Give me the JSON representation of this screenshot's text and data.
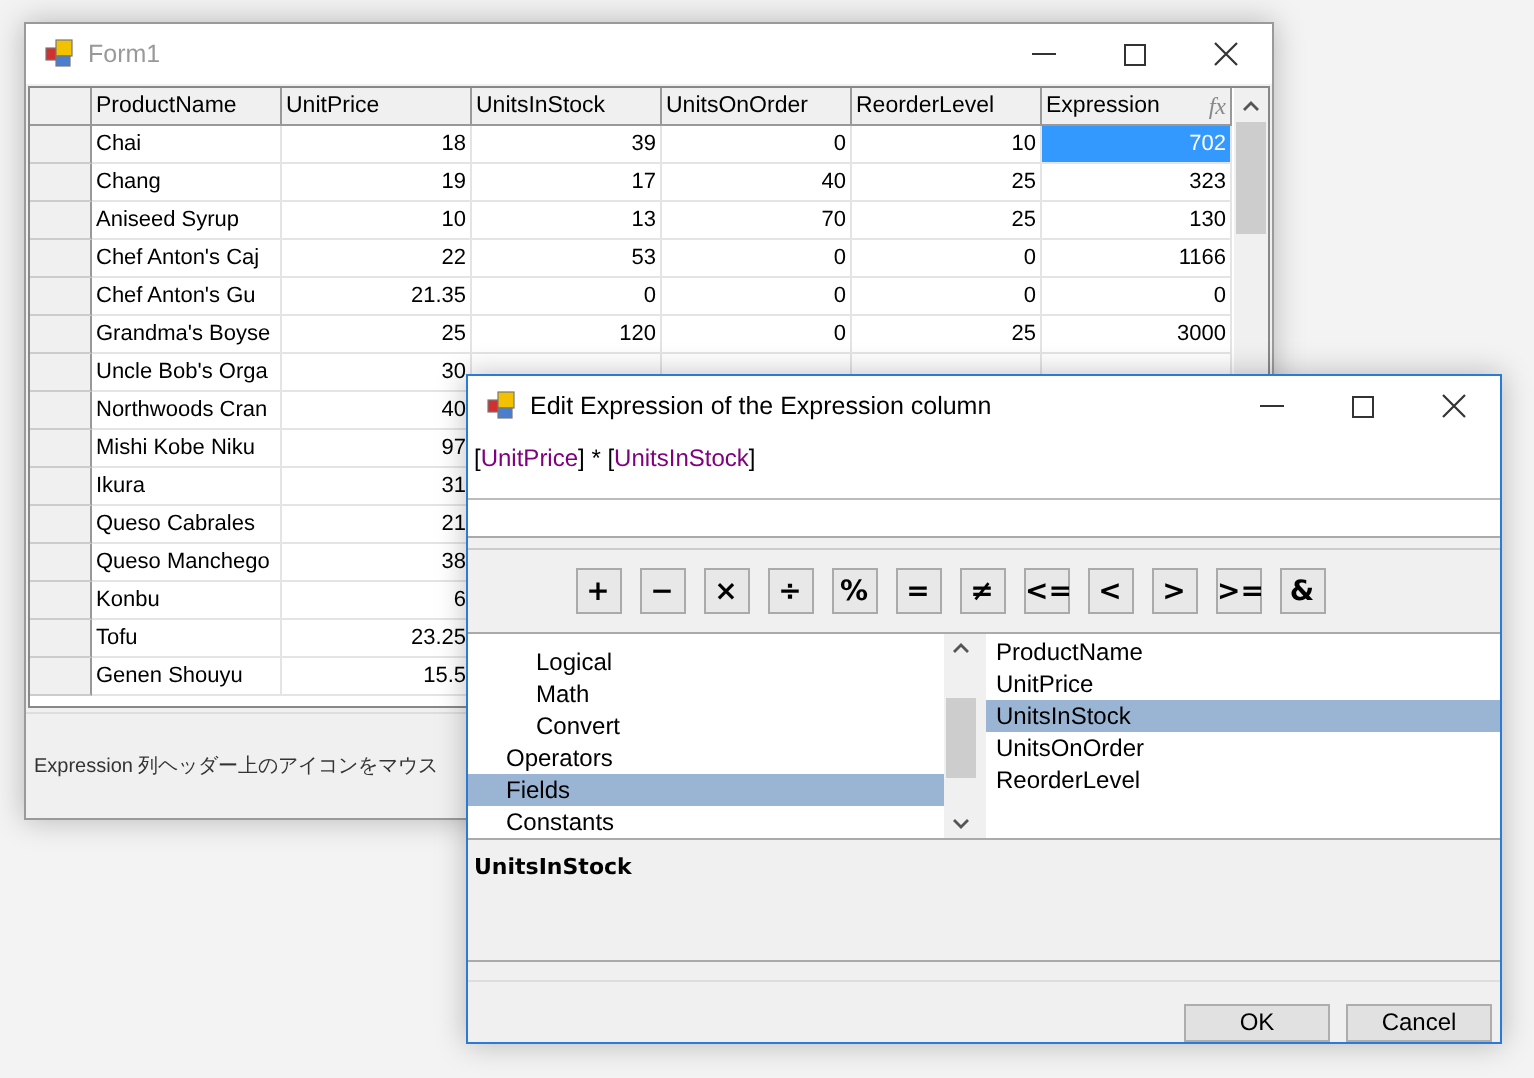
{
  "main_window": {
    "title": "Form1",
    "grid": {
      "columns": [
        "ProductName",
        "UnitPrice",
        "UnitsInStock",
        "UnitsOnOrder",
        "ReorderLevel",
        "Expression"
      ],
      "expression_header_icon": "fx",
      "rows": [
        {
          "cells": [
            "Chai",
            "18",
            "39",
            "0",
            "10"
          ],
          "expression": {
            "value": "702",
            "selected": true
          }
        },
        {
          "cells": [
            "Chang",
            "19",
            "17",
            "40",
            "25"
          ],
          "expression": {
            "value": "323",
            "selected": false
          }
        },
        {
          "cells": [
            "Aniseed Syrup",
            "10",
            "13",
            "70",
            "25"
          ],
          "expression": {
            "value": "130",
            "selected": false
          }
        },
        {
          "cells": [
            "Chef Anton's Caj",
            "22",
            "53",
            "0",
            "0"
          ],
          "expression": {
            "value": "1166",
            "selected": false
          }
        },
        {
          "cells": [
            "Chef Anton's Gu",
            "21.35",
            "0",
            "0",
            "0"
          ],
          "expression": {
            "value": "0",
            "selected": false
          }
        },
        {
          "cells": [
            "Grandma's Boyse",
            "25",
            "120",
            "0",
            "25"
          ],
          "expression": {
            "value": "3000",
            "selected": false
          }
        },
        {
          "cells": [
            "Uncle Bob's Orga",
            "30"
          ]
        },
        {
          "cells": [
            "Northwoods Cran",
            "40"
          ]
        },
        {
          "cells": [
            "Mishi Kobe Niku",
            "97"
          ]
        },
        {
          "cells": [
            "Ikura",
            "31"
          ]
        },
        {
          "cells": [
            "Queso Cabrales",
            "21"
          ]
        },
        {
          "cells": [
            "Queso Manchego",
            "38"
          ]
        },
        {
          "cells": [
            "Konbu",
            "6"
          ]
        },
        {
          "cells": [
            "Tofu",
            "23.25"
          ]
        },
        {
          "cells": [
            "Genen Shouyu",
            "15.5"
          ]
        }
      ]
    },
    "status_text": "Expression 列ヘッダー上のアイコンをマウス"
  },
  "dialog": {
    "title": "Edit Expression of the Expression column",
    "expression": [
      {
        "text": "[",
        "kind": "bracket"
      },
      {
        "text": "UnitPrice",
        "kind": "field"
      },
      {
        "text": "] * [",
        "kind": "bracket"
      },
      {
        "text": "UnitsInStock",
        "kind": "field"
      },
      {
        "text": "]",
        "kind": "bracket"
      }
    ],
    "operators": [
      "+",
      "−",
      "×",
      "÷",
      "%",
      "=",
      "≠",
      "<=",
      "<",
      ">",
      ">=",
      "&"
    ],
    "tree": {
      "cut_group_children": [
        {
          "label": "Logical",
          "selected": false
        },
        {
          "label": "Math",
          "selected": false
        },
        {
          "label": "Convert",
          "selected": false
        }
      ],
      "items": [
        {
          "label": "Operators",
          "selected": false
        },
        {
          "label": "Fields",
          "selected": true
        },
        {
          "label": "Constants",
          "selected": false
        }
      ]
    },
    "fields": [
      {
        "label": "ProductName",
        "selected": false
      },
      {
        "label": "UnitPrice",
        "selected": false
      },
      {
        "label": "UnitsInStock",
        "selected": true
      },
      {
        "label": "UnitsOnOrder",
        "selected": false
      },
      {
        "label": "ReorderLevel",
        "selected": false
      }
    ],
    "description": "UnitsInStock",
    "buttons": [
      "OK",
      "Cancel"
    ]
  }
}
